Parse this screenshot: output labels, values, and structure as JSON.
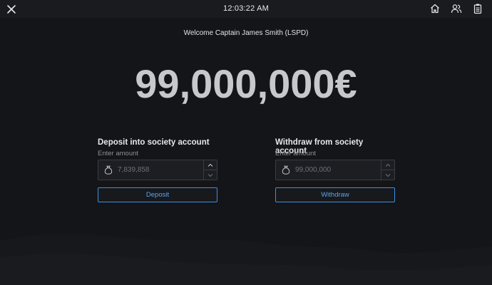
{
  "header": {
    "time": "12:03:22 AM",
    "icons": [
      "close-icon",
      "home-icon",
      "users-icon",
      "clipboard-icon"
    ]
  },
  "welcome": {
    "text": "Welcome Captain James Smith (LSPD)"
  },
  "balance": {
    "display": "99,000,000€"
  },
  "deposit": {
    "title": "Deposit into society account",
    "subtitle": "Enter amount",
    "placeholder": "7,839,858",
    "button_label": "Deposit"
  },
  "withdraw": {
    "title": "Withdraw from society account",
    "subtitle": "Enter amount",
    "placeholder": "99,000,000",
    "button_label": "Withdraw"
  },
  "colors": {
    "background": "#141518",
    "topbar": "#1a1b1f",
    "accent": "#3d8fe0",
    "balance_text": "#c7c8cc"
  }
}
